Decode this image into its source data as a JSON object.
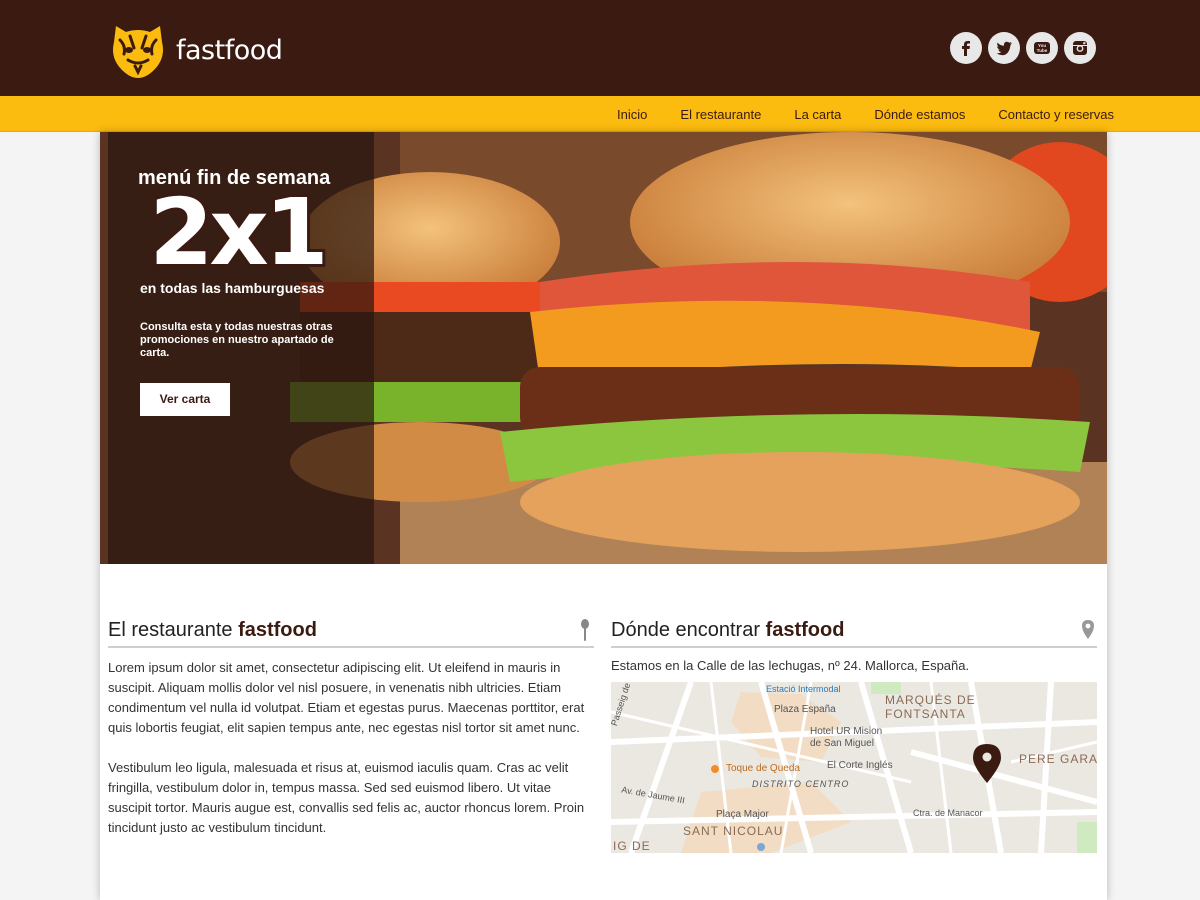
{
  "header": {
    "brand": "fastfood",
    "social": [
      {
        "name": "facebook-icon",
        "glyph": "f"
      },
      {
        "name": "twitter-icon",
        "glyph": "t"
      },
      {
        "name": "youtube-icon",
        "glyph": "You Tube"
      },
      {
        "name": "instagram-icon",
        "glyph": ""
      }
    ]
  },
  "nav": {
    "items": [
      "Inicio",
      "El restaurante",
      "La carta",
      "Dónde estamos",
      "Contacto y reservas"
    ]
  },
  "hero": {
    "title": "menú fin de semana",
    "big": "2x1",
    "subtitle": "en todas las hamburguesas",
    "description": "Consulta esta y todas nuestras otras promociones en nuestro apartado de carta.",
    "button": "Ver carta"
  },
  "restaurant": {
    "heading_prefix": "El restaurante ",
    "heading_bold": "fastfood",
    "paragraph1": "Lorem ipsum dolor sit amet, consectetur adipiscing elit. Ut eleifend in mauris in suscipit. Aliquam mollis dolor vel nisl posuere, in venenatis nibh ultricies. Etiam condimentum vel nulla id volutpat. Etiam et egestas purus. Maecenas porttitor, erat quis lobortis feugiat, elit sapien tempus ante, nec egestas nisl tortor sit amet nunc.",
    "paragraph2": "Vestibulum leo ligula, malesuada et risus at, euismod iaculis quam. Cras ac velit fringilla, vestibulum dolor in, tempus massa. Sed sed euismod libero. Ut vitae suscipit tortor. Mauris augue est, convallis sed felis ac, auctor rhoncus lorem. Proin tincidunt justo ac vestibulum tincidunt."
  },
  "location": {
    "heading_prefix": "Dónde encontrar ",
    "heading_bold": "fastfood",
    "address": "Estamos en la Calle de las lechugas, nº 24. Mallorca, España.",
    "map_labels": {
      "station": "Estació Intermodal",
      "marques": "MARQUÉS DE",
      "fontsanta": "FONTSANTA",
      "plaza_espana": "Plaza España",
      "hotel1": "Hotel UR Mision",
      "hotel2": "de San Miguel",
      "pere": "PERE GARA",
      "passeig": "Passeig de Mallorca",
      "toque": "Toque de Queda",
      "corte": "El Corte Inglés",
      "jaume": "Av. de Jaume III",
      "distrito": "DISTRITO CENTRO",
      "placa_major": "Plaça Major",
      "manacor": "Ctra. de Manacor",
      "sant_nicolau": "SANT NICOLAU",
      "ig_de": "IG DE"
    }
  },
  "colors": {
    "header_bg": "#3b1b11",
    "nav_bg": "#fbbb0f",
    "accent_dark": "#3b1b11"
  }
}
